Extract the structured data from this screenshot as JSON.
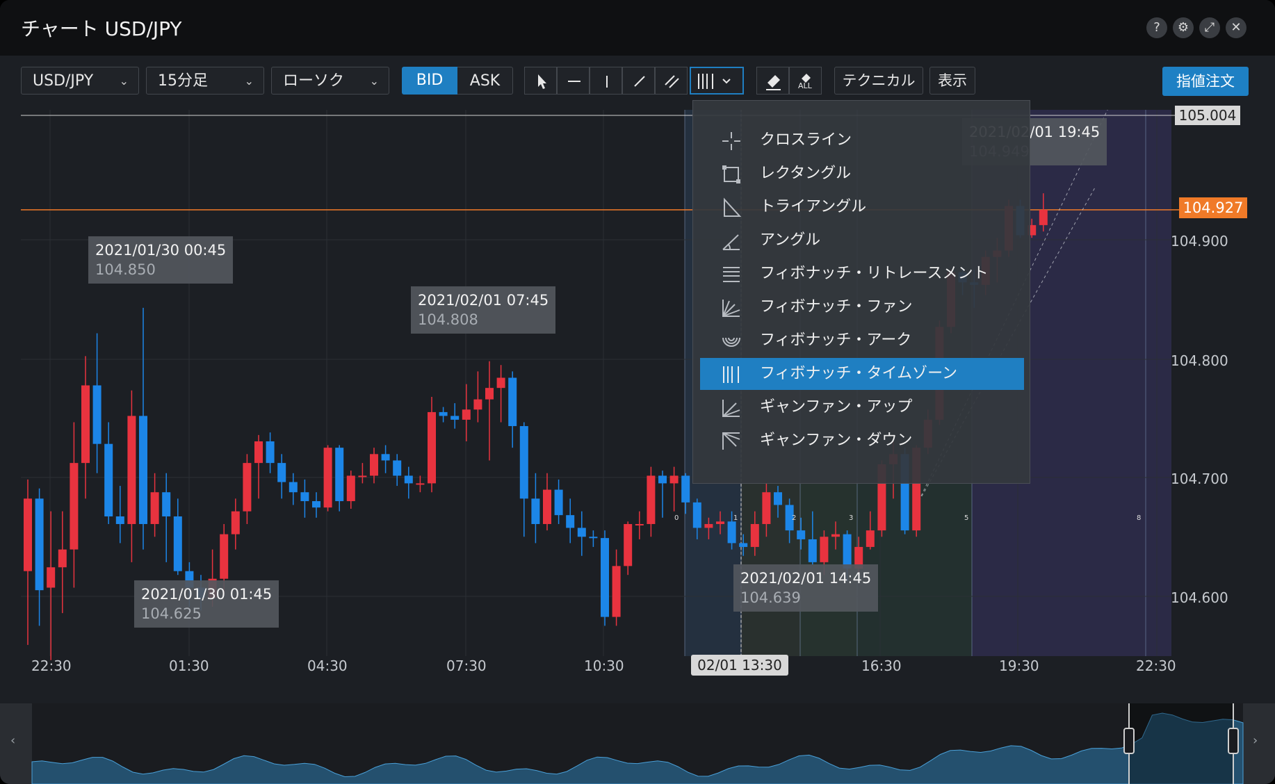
{
  "window": {
    "title": "チャート USD/JPY"
  },
  "title_buttons": {
    "help": "?",
    "settings": "⚙",
    "expand": "⤢",
    "close": "✕"
  },
  "toolbar": {
    "symbol": "USD/JPY",
    "timeframe": "15分足",
    "chart_type": "ローソク",
    "bid_label": "BID",
    "ask_label": "ASK",
    "technical_label": "テクニカル",
    "display_label": "表示",
    "all_label": "ALL",
    "order_label": "指値注文"
  },
  "menu": {
    "items": [
      {
        "label": "クロスライン",
        "icon": "crossline-icon"
      },
      {
        "label": "レクタングル",
        "icon": "rectangle-icon"
      },
      {
        "label": "トライアングル",
        "icon": "triangle-icon"
      },
      {
        "label": "アングル",
        "icon": "angle-icon"
      },
      {
        "label": "フィボナッチ・リトレースメント",
        "icon": "fibonacci-retracement-icon"
      },
      {
        "label": "フィボナッチ・ファン",
        "icon": "fibonacci-fan-icon"
      },
      {
        "label": "フィボナッチ・アーク",
        "icon": "fibonacci-arc-icon"
      },
      {
        "label": "フィボナッチ・タイムゾーン",
        "icon": "fibonacci-timezone-icon",
        "selected": true
      },
      {
        "label": "ギャンファン・アップ",
        "icon": "gann-fan-up-icon"
      },
      {
        "label": "ギャンファン・ダウン",
        "icon": "gann-fan-down-icon"
      }
    ]
  },
  "chart_data": {
    "type": "candlestick",
    "title": "",
    "y_axis": {
      "ticks": [
        "104.600",
        "104.700",
        "104.800",
        "104.900"
      ],
      "min": 104.58,
      "max": 105.01
    },
    "x_axis": {
      "ticks": [
        "22:30",
        "01:30",
        "04:30",
        "07:30",
        "10:30",
        "13:30",
        "16:30",
        "19:30",
        "22:30"
      ]
    },
    "crosshair_time": "02/01 13:30",
    "current_price": "104.927",
    "top_price_label": "105.004",
    "colors": {
      "up": "#e8333f",
      "down": "#1c86e8",
      "price_line": "#f07a28",
      "selected": "#1f7fc2"
    },
    "callouts": [
      {
        "date": "2021/01/30 00:45",
        "price": "104.850"
      },
      {
        "date": "2021/01/30 01:45",
        "price": "104.625"
      },
      {
        "date": "2021/02/01 07:45",
        "price": "104.808"
      },
      {
        "date": "2021/02/01 14:45",
        "price": "104.639"
      },
      {
        "date": "2021/02/01 19:45",
        "price": "104.949"
      }
    ],
    "fib_timezone_labels": [
      "0",
      "1",
      "2",
      "3",
      "5",
      "8"
    ],
    "candles": [
      {
        "o": 104.643,
        "c": 104.7,
        "h": 104.715,
        "l": 104.585
      },
      {
        "o": 104.7,
        "c": 104.628,
        "h": 104.708,
        "l": 104.6
      },
      {
        "o": 104.63,
        "c": 104.646,
        "h": 104.69,
        "l": 104.573
      },
      {
        "o": 104.646,
        "c": 104.66,
        "h": 104.69,
        "l": 104.61
      },
      {
        "o": 104.66,
        "c": 104.728,
        "h": 104.76,
        "l": 104.63
      },
      {
        "o": 104.728,
        "c": 104.789,
        "h": 104.812,
        "l": 104.7
      },
      {
        "o": 104.789,
        "c": 104.743,
        "h": 104.83,
        "l": 104.72
      },
      {
        "o": 104.743,
        "c": 104.686,
        "h": 104.76,
        "l": 104.68
      },
      {
        "o": 104.686,
        "c": 104.68,
        "h": 104.71,
        "l": 104.665
      },
      {
        "o": 104.68,
        "c": 104.765,
        "h": 104.785,
        "l": 104.65
      },
      {
        "o": 104.765,
        "c": 104.68,
        "h": 104.85,
        "l": 104.66
      },
      {
        "o": 104.68,
        "c": 104.705,
        "h": 104.72,
        "l": 104.67
      },
      {
        "o": 104.705,
        "c": 104.686,
        "h": 104.72,
        "l": 104.65
      },
      {
        "o": 104.686,
        "c": 104.643,
        "h": 104.7,
        "l": 104.64
      },
      {
        "o": 104.643,
        "c": 104.63,
        "h": 104.65,
        "l": 104.615
      },
      {
        "o": 104.63,
        "c": 104.622,
        "h": 104.64,
        "l": 104.612
      },
      {
        "o": 104.622,
        "c": 104.637,
        "h": 104.66,
        "l": 104.615
      },
      {
        "o": 104.637,
        "c": 104.672,
        "h": 104.68,
        "l": 104.625
      },
      {
        "o": 104.672,
        "c": 104.69,
        "h": 104.7,
        "l": 104.66
      },
      {
        "o": 104.69,
        "c": 104.728,
        "h": 104.735,
        "l": 104.68
      },
      {
        "o": 104.728,
        "c": 104.745,
        "h": 104.75,
        "l": 104.7
      },
      {
        "o": 104.745,
        "c": 104.728,
        "h": 104.752,
        "l": 104.72
      },
      {
        "o": 104.728,
        "c": 104.713,
        "h": 104.735,
        "l": 104.7
      },
      {
        "o": 104.713,
        "c": 104.705,
        "h": 104.72,
        "l": 104.695
      },
      {
        "o": 104.705,
        "c": 104.698,
        "h": 104.715,
        "l": 104.685
      },
      {
        "o": 104.698,
        "c": 104.693,
        "h": 104.705,
        "l": 104.685
      },
      {
        "o": 104.693,
        "c": 104.74,
        "h": 104.742,
        "l": 104.69
      },
      {
        "o": 104.74,
        "c": 104.698,
        "h": 104.742,
        "l": 104.69
      },
      {
        "o": 104.698,
        "c": 104.718,
        "h": 104.722,
        "l": 104.692
      },
      {
        "o": 104.718,
        "c": 104.718,
        "h": 104.728,
        "l": 104.712
      },
      {
        "o": 104.718,
        "c": 104.735,
        "h": 104.74,
        "l": 104.712
      },
      {
        "o": 104.735,
        "c": 104.73,
        "h": 104.742,
        "l": 104.72
      },
      {
        "o": 104.73,
        "c": 104.718,
        "h": 104.735,
        "l": 104.71
      },
      {
        "o": 104.718,
        "c": 104.712,
        "h": 104.725,
        "l": 104.7
      },
      {
        "o": 104.712,
        "c": 104.712,
        "h": 104.718,
        "l": 104.705
      },
      {
        "o": 104.712,
        "c": 104.768,
        "h": 104.78,
        "l": 104.705
      },
      {
        "o": 104.768,
        "c": 104.765,
        "h": 104.772,
        "l": 104.76
      },
      {
        "o": 104.765,
        "c": 104.762,
        "h": 104.775,
        "l": 104.755
      },
      {
        "o": 104.762,
        "c": 104.77,
        "h": 104.79,
        "l": 104.745
      },
      {
        "o": 104.77,
        "c": 104.778,
        "h": 104.8,
        "l": 104.76
      },
      {
        "o": 104.778,
        "c": 104.787,
        "h": 104.808,
        "l": 104.73
      },
      {
        "o": 104.787,
        "c": 104.795,
        "h": 104.805,
        "l": 104.76
      },
      {
        "o": 104.795,
        "c": 104.757,
        "h": 104.8,
        "l": 104.74
      },
      {
        "o": 104.757,
        "c": 104.7,
        "h": 104.76,
        "l": 104.67
      },
      {
        "o": 104.7,
        "c": 104.68,
        "h": 104.72,
        "l": 104.665
      },
      {
        "o": 104.68,
        "c": 104.707,
        "h": 104.72,
        "l": 104.675
      },
      {
        "o": 104.707,
        "c": 104.687,
        "h": 104.715,
        "l": 104.68
      },
      {
        "o": 104.687,
        "c": 104.677,
        "h": 104.7,
        "l": 104.665
      },
      {
        "o": 104.677,
        "c": 104.67,
        "h": 104.69,
        "l": 104.655
      },
      {
        "o": 104.67,
        "c": 104.669,
        "h": 104.675,
        "l": 104.662
      },
      {
        "o": 104.669,
        "c": 104.607,
        "h": 104.675,
        "l": 104.6
      },
      {
        "o": 104.607,
        "c": 104.647,
        "h": 104.66,
        "l": 104.6
      },
      {
        "o": 104.647,
        "c": 104.68,
        "h": 104.682,
        "l": 104.64
      },
      {
        "o": 104.68,
        "c": 104.68,
        "h": 104.69,
        "l": 104.668
      },
      {
        "o": 104.68,
        "c": 104.718,
        "h": 104.725,
        "l": 104.67
      },
      {
        "o": 104.718,
        "c": 104.712,
        "h": 104.722,
        "l": 104.685
      },
      {
        "o": 104.712,
        "c": 104.718,
        "h": 104.725,
        "l": 104.69
      },
      {
        "o": 104.718,
        "c": 104.697,
        "h": 104.72,
        "l": 104.688
      },
      {
        "o": 104.697,
        "c": 104.677,
        "h": 104.7,
        "l": 104.668
      },
      {
        "o": 104.677,
        "c": 104.68,
        "h": 104.685,
        "l": 104.668
      },
      {
        "o": 104.68,
        "c": 104.682,
        "h": 104.69,
        "l": 104.672
      },
      {
        "o": 104.682,
        "c": 104.665,
        "h": 104.69,
        "l": 104.66
      },
      {
        "o": 104.665,
        "c": 104.662,
        "h": 104.672,
        "l": 104.655
      },
      {
        "o": 104.662,
        "c": 104.68,
        "h": 104.69,
        "l": 104.655
      },
      {
        "o": 104.68,
        "c": 104.705,
        "h": 104.712,
        "l": 104.67
      },
      {
        "o": 104.705,
        "c": 104.695,
        "h": 104.71,
        "l": 104.685
      },
      {
        "o": 104.695,
        "c": 104.675,
        "h": 104.7,
        "l": 104.665
      },
      {
        "o": 104.675,
        "c": 104.668,
        "h": 104.685,
        "l": 104.66
      },
      {
        "o": 104.668,
        "c": 104.65,
        "h": 104.69,
        "l": 104.648
      },
      {
        "o": 104.65,
        "c": 104.67,
        "h": 104.675,
        "l": 104.64
      },
      {
        "o": 104.67,
        "c": 104.672,
        "h": 104.682,
        "l": 104.66
      },
      {
        "o": 104.672,
        "c": 104.645,
        "h": 104.675,
        "l": 104.635
      },
      {
        "o": 104.645,
        "c": 104.662,
        "h": 104.67,
        "l": 104.64
      },
      {
        "o": 104.662,
        "c": 104.675,
        "h": 104.69,
        "l": 104.66
      },
      {
        "o": 104.675,
        "c": 104.727,
        "h": 104.73,
        "l": 104.67
      },
      {
        "o": 104.727,
        "c": 104.735,
        "h": 104.745,
        "l": 104.7
      },
      {
        "o": 104.735,
        "c": 104.675,
        "h": 104.74,
        "l": 104.672
      },
      {
        "o": 104.675,
        "c": 104.74,
        "h": 104.742,
        "l": 104.67
      },
      {
        "o": 104.74,
        "c": 104.762,
        "h": 104.77,
        "l": 104.735
      },
      {
        "o": 104.762,
        "c": 104.835,
        "h": 104.84,
        "l": 104.758
      },
      {
        "o": 104.835,
        "c": 104.878,
        "h": 104.88,
        "l": 104.83
      },
      {
        "o": 104.878,
        "c": 104.87,
        "h": 104.882,
        "l": 104.86
      },
      {
        "o": 104.87,
        "c": 104.868,
        "h": 104.88,
        "l": 104.85
      },
      {
        "o": 104.868,
        "c": 104.89,
        "h": 104.895,
        "l": 104.86
      },
      {
        "o": 104.89,
        "c": 104.895,
        "h": 104.905,
        "l": 104.87
      },
      {
        "o": 104.895,
        "c": 104.93,
        "h": 104.935,
        "l": 104.89
      },
      {
        "o": 104.93,
        "c": 104.907,
        "h": 104.935,
        "l": 104.905
      },
      {
        "o": 104.907,
        "c": 104.915,
        "h": 104.92,
        "l": 104.905
      },
      {
        "o": 104.915,
        "c": 104.927,
        "h": 104.94,
        "l": 104.91
      }
    ]
  }
}
